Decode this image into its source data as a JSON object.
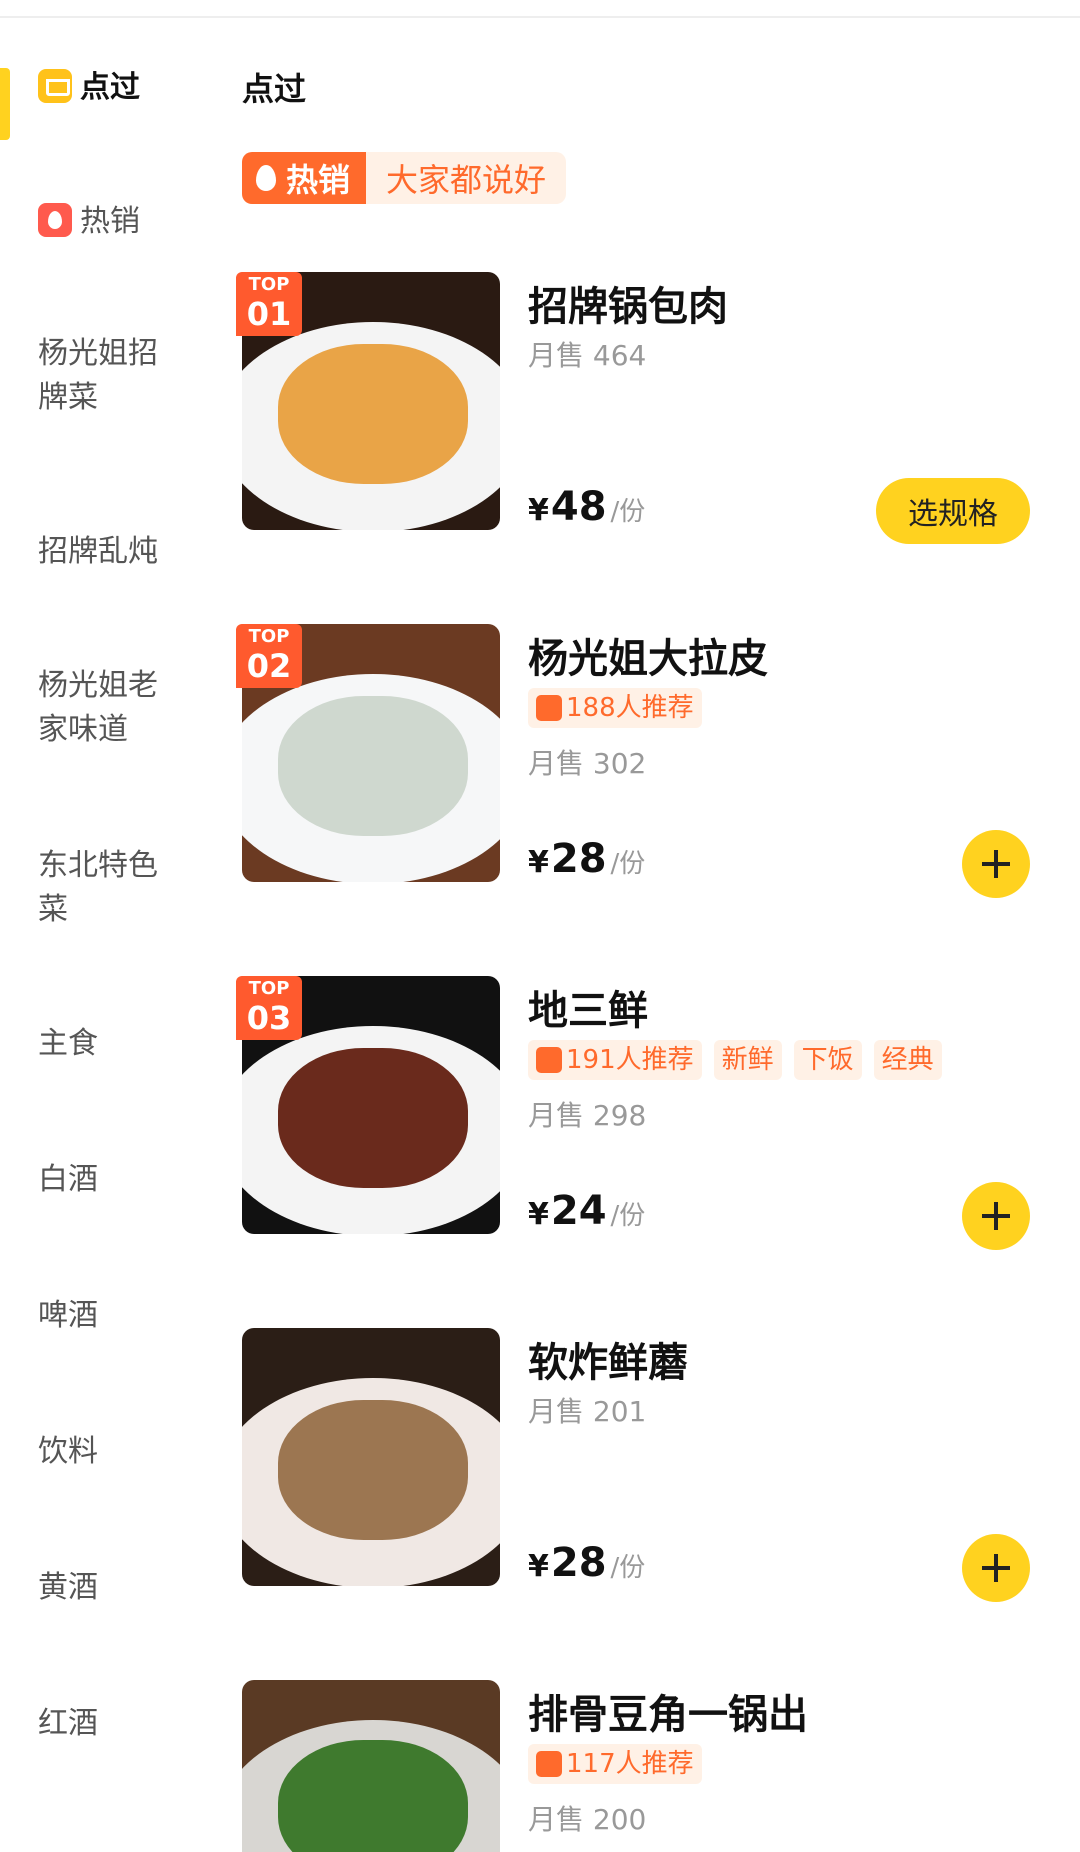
{
  "colors": {
    "accent": "#ffd21f",
    "hot": "#ff6a2c",
    "hot_bg": "#fff1e6"
  },
  "sidebar": {
    "items": [
      {
        "label": "点过",
        "icon": "cart-icon",
        "active": true
      },
      {
        "label": "热销",
        "icon": "fire-icon"
      },
      {
        "label": "杨光姐招\n牌菜"
      },
      {
        "label": "招牌乱炖"
      },
      {
        "label": "杨光姐老\n家味道"
      },
      {
        "label": "东北特色\n菜"
      },
      {
        "label": "主食"
      },
      {
        "label": "白酒"
      },
      {
        "label": "啤酒"
      },
      {
        "label": "饮料"
      },
      {
        "label": "黄酒"
      },
      {
        "label": "红酒"
      }
    ]
  },
  "main": {
    "section_title": "点过",
    "hot_banner": {
      "left": "热销",
      "right": "大家都说好"
    },
    "items": [
      {
        "name": "招牌锅包肉",
        "top_label": "TOP",
        "rank": "01",
        "tags": [],
        "sales": "月售 464",
        "currency": "¥",
        "price": "48",
        "unit": "/份",
        "action": "选规格"
      },
      {
        "name": "杨光姐大拉皮",
        "top_label": "TOP",
        "rank": "02",
        "recommend": "188人推荐",
        "sales": "月售 302",
        "currency": "¥",
        "price": "28",
        "unit": "/份",
        "action": "add"
      },
      {
        "name": "地三鲜",
        "top_label": "TOP",
        "rank": "03",
        "recommend": "191人推荐",
        "tags": [
          "新鲜",
          "下饭",
          "经典"
        ],
        "sales": "月售 298",
        "currency": "¥",
        "price": "24",
        "unit": "/份",
        "action": "add"
      },
      {
        "name": "软炸鲜蘑",
        "sales": "月售 201",
        "currency": "¥",
        "price": "28",
        "unit": "/份",
        "action": "add"
      },
      {
        "name": "排骨豆角一锅出",
        "recommend": "117人推荐",
        "sales": "月售 200"
      }
    ]
  }
}
